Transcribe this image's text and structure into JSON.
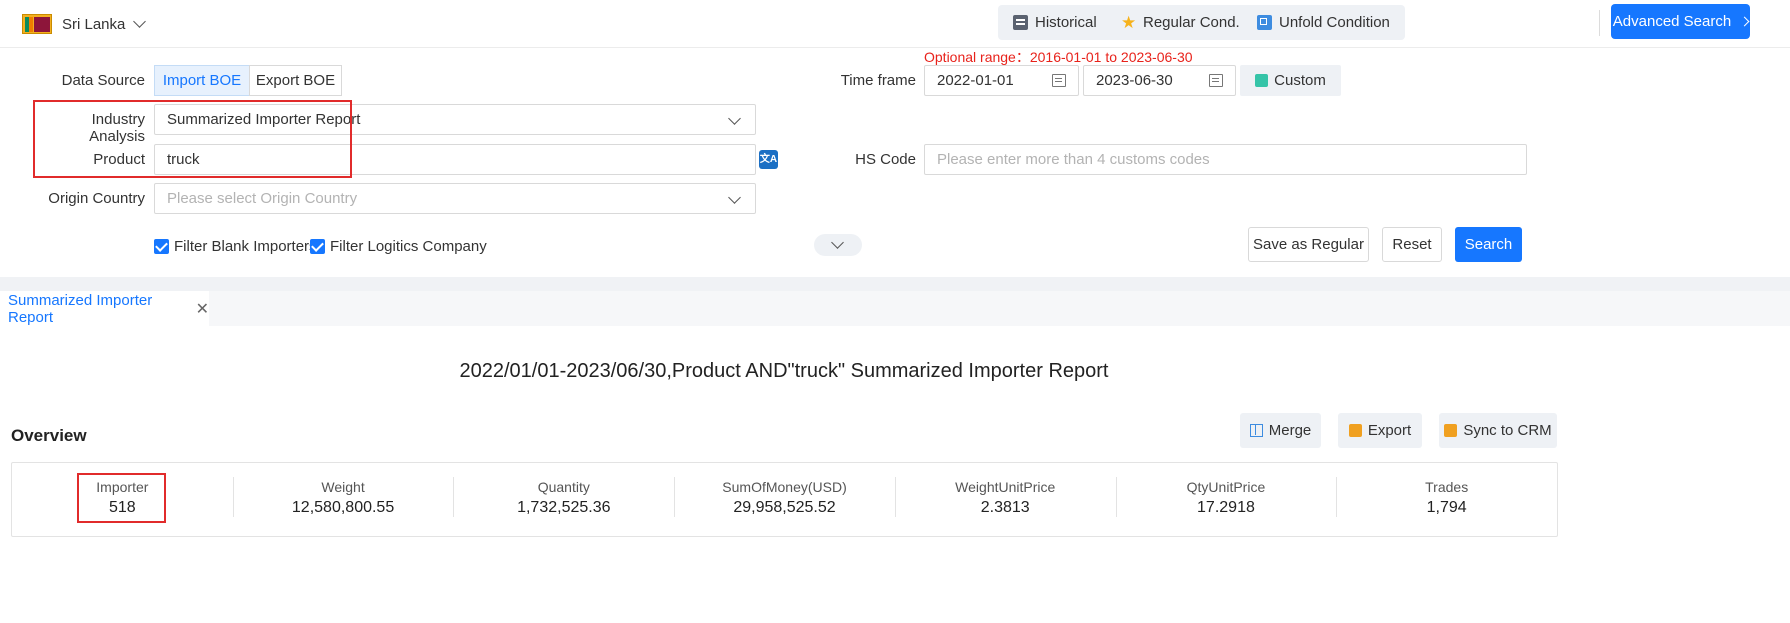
{
  "header": {
    "country": "Sri Lanka",
    "historical_label": "Historical",
    "regular_cond_label": "Regular Cond.",
    "unfold_label": "Unfold Condition",
    "advanced_search_label": "Advanced Search"
  },
  "form": {
    "optional_range": "Optional range：2016-01-01 to 2023-06-30",
    "data_source_label": "Data Source",
    "import_boe_label": "Import BOE",
    "export_boe_label": "Export BOE",
    "time_frame_label": "Time frame",
    "date_from": "2022-01-01",
    "date_to": "2023-06-30",
    "custom_label": "Custom",
    "industry_label": "Industry Analysis",
    "industry_value": "Summarized Importer Report",
    "product_label": "Product",
    "product_value": "truck",
    "hs_label": "HS Code",
    "hs_placeholder": "Please enter more than 4 customs codes",
    "origin_label": "Origin Country",
    "origin_placeholder": "Please select Origin Country",
    "filter_blank_label": "Filter Blank Importers",
    "filter_logistics_label": "Filter Logitics Company",
    "save_regular_label": "Save as Regular",
    "reset_label": "Reset",
    "search_label": "Search"
  },
  "tabs": [
    {
      "label": "Summarized Importer Report"
    }
  ],
  "report": {
    "title": "2022/01/01-2023/06/30,Product AND\"truck\" Summarized Importer Report",
    "overview_label": "Overview",
    "merge_label": "Merge",
    "export_label": "Export",
    "sync_label": "Sync to CRM",
    "stats": [
      {
        "key": "Importer",
        "value": "518"
      },
      {
        "key": "Weight",
        "value": "12,580,800.55"
      },
      {
        "key": "Quantity",
        "value": "1,732,525.36"
      },
      {
        "key": "SumOfMoney(USD)",
        "value": "29,958,525.52"
      },
      {
        "key": "WeightUnitPrice",
        "value": "2.3813"
      },
      {
        "key": "QtyUnitPrice",
        "value": "17.2918"
      },
      {
        "key": "Trades",
        "value": "1,794"
      }
    ]
  },
  "colors": {
    "primary": "#1677ff",
    "highlight": "#e12b2b",
    "hint": "#e8221b"
  }
}
